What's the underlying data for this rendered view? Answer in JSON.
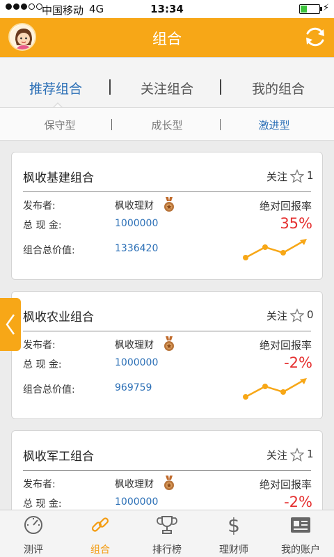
{
  "status_bar": {
    "carrier": "中国移动",
    "network": "4G",
    "time": "13:34",
    "battery_level": 0.3
  },
  "header": {
    "title": "组合",
    "refresh_icon": "refresh-icon",
    "avatar_icon": "avatar-icon"
  },
  "main_tabs": [
    {
      "label": "推荐组合",
      "active": true
    },
    {
      "label": "关注组合",
      "active": false
    },
    {
      "label": "我的组合",
      "active": false
    }
  ],
  "sub_tabs": [
    {
      "label": "保守型",
      "active": false
    },
    {
      "label": "成长型",
      "active": false
    },
    {
      "label": "激进型",
      "active": true
    }
  ],
  "card_labels": {
    "follow": "关注",
    "publisher": "发布者:",
    "cash": "总 现 金:",
    "total_value": "组合总价值:",
    "return": "绝对回报率"
  },
  "portfolios": [
    {
      "name": "枫收基建组合",
      "follow_count": "1",
      "publisher": "枫收理财",
      "cash": "1000000",
      "total_value": "1336420",
      "return": "35%"
    },
    {
      "name": "枫收农业组合",
      "follow_count": "0",
      "publisher": "枫收理财",
      "cash": "1000000",
      "total_value": "969759",
      "return": "-2%"
    },
    {
      "name": "枫收军工组合",
      "follow_count": "1",
      "publisher": "枫收理财",
      "cash": "1000000",
      "total_value": "",
      "return": "-2%"
    }
  ],
  "bottom_nav": [
    {
      "label": "测评",
      "icon": "gauge-icon",
      "active": false
    },
    {
      "label": "组合",
      "icon": "link-icon",
      "active": true
    },
    {
      "label": "排行榜",
      "icon": "trophy-icon",
      "active": false
    },
    {
      "label": "理财师",
      "icon": "dollar-icon",
      "active": false
    },
    {
      "label": "我的账户",
      "icon": "account-card-icon",
      "active": false
    }
  ],
  "colors": {
    "accent": "#f7a717",
    "link_blue": "#2b6fb6",
    "return_red": "#e53030"
  }
}
